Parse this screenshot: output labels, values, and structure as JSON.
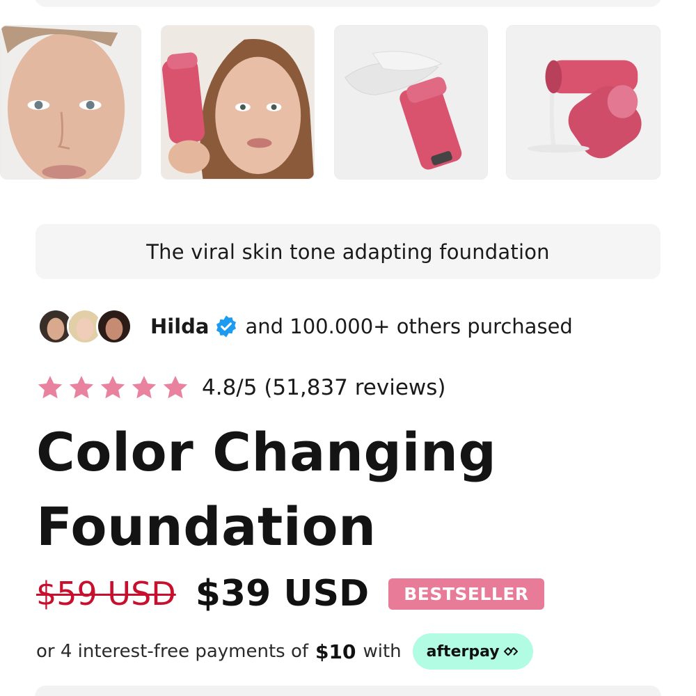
{
  "gallery": {
    "thumbnails": [
      {
        "name": "model-mature-face"
      },
      {
        "name": "model-holding-product"
      },
      {
        "name": "product-swatch"
      },
      {
        "name": "product-bottles"
      }
    ]
  },
  "product": {
    "tagline": "The viral skin tone adapting foundation",
    "social_proof": {
      "buyer_name": "Hilda",
      "purchased_text": "and 100.000+ others purchased"
    },
    "rating": {
      "stars": 5,
      "text": "4.8/5 (51,837 reviews)"
    },
    "title_line1": "Color Changing",
    "title_line2": "Foundation",
    "price": {
      "original": "$59 USD",
      "current": "$39 USD",
      "badge": "BESTSELLER"
    },
    "installments": {
      "prefix": "or 4 interest-free payments of",
      "amount": "$10",
      "suffix": "with",
      "provider": "afterpay"
    }
  },
  "colors": {
    "star": "#e9829e",
    "badge": "#e77b98",
    "strike_price": "#c8102e",
    "afterpay_bg": "#b2fce4",
    "verified": "#1d9bf0",
    "product_pink": "#d9536e"
  }
}
